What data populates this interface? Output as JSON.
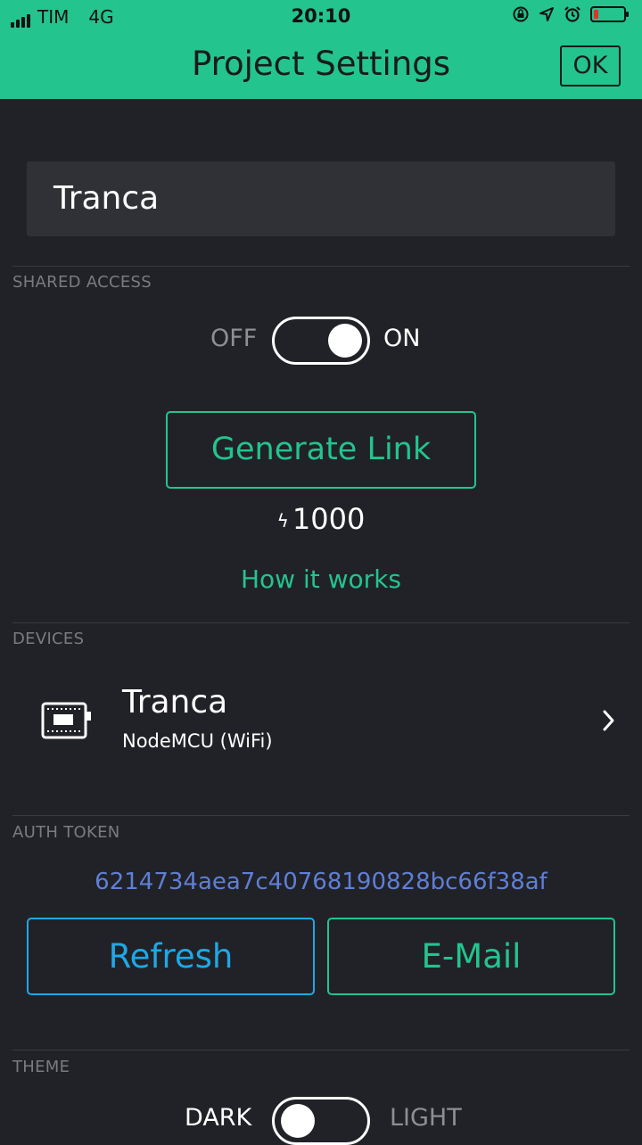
{
  "status": {
    "carrier": "TIM",
    "network": "4G",
    "time": "20:10"
  },
  "header": {
    "title": "Project Settings",
    "ok_label": "OK"
  },
  "project": {
    "name": "Tranca"
  },
  "shared_access": {
    "section_label": "SHARED ACCESS",
    "off_label": "OFF",
    "on_label": "ON",
    "enabled": true,
    "generate_label": "Generate Link",
    "energy": "1000",
    "how_label": "How it works"
  },
  "devices": {
    "section_label": "DEVICES",
    "items": [
      {
        "name": "Tranca",
        "type": "NodeMCU (WiFi)"
      }
    ]
  },
  "auth_token": {
    "section_label": "AUTH TOKEN",
    "value": "6214734aea7c40768190828bc66f38af",
    "refresh_label": "Refresh",
    "email_label": "E-Mail"
  },
  "theme": {
    "section_label": "THEME",
    "dark_label": "DARK",
    "light_label": "LIGHT",
    "selected": "dark"
  },
  "colors": {
    "accent": "#23c48e",
    "background": "#212227",
    "refresh": "#1fa8e6",
    "token": "#5f7fd6"
  }
}
